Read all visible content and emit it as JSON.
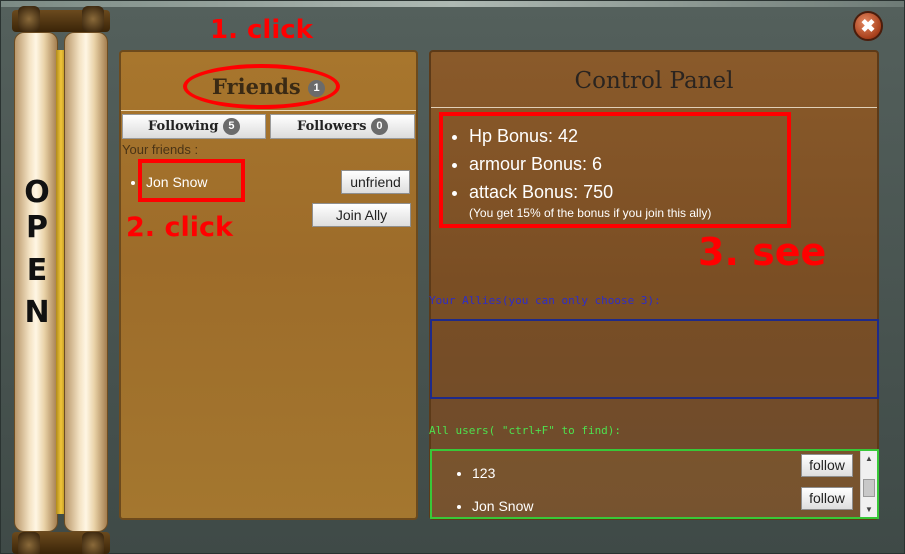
{
  "window": {
    "close_symbol": "✖"
  },
  "scroll": {
    "letters": [
      "O",
      "P",
      "E",
      "N"
    ]
  },
  "friends_panel": {
    "title": "Friends",
    "title_count": "1",
    "tabs": [
      {
        "label": "Following",
        "count": "5"
      },
      {
        "label": "Followers",
        "count": "0"
      }
    ],
    "your_friends_label": "Your friends :",
    "friends": [
      {
        "name": "Jon Snow"
      }
    ],
    "unfriend_label": "unfriend",
    "join_ally_label": "Join Ally"
  },
  "control_panel": {
    "title": "Control Panel",
    "bonuses": [
      "Hp Bonus: 42",
      "armour Bonus: 6",
      "attack Bonus: 750"
    ],
    "bonus_note": "(You get 15% of the bonus if you join this ally)",
    "allies_label": "Your Allies(you can only choose 3):",
    "all_users_label": "All users( \"ctrl+F\" to find):",
    "users": [
      {
        "name": "123",
        "action": "follow"
      },
      {
        "name": "Jon Snow",
        "action": "follow"
      }
    ]
  },
  "annotations": {
    "step1": "1. click",
    "step2": "2. click",
    "step3": "3. see"
  },
  "colors": {
    "annotation_red": "#ff0000",
    "allies_label": "#2d2dc8",
    "users_label": "#4ee04e"
  }
}
